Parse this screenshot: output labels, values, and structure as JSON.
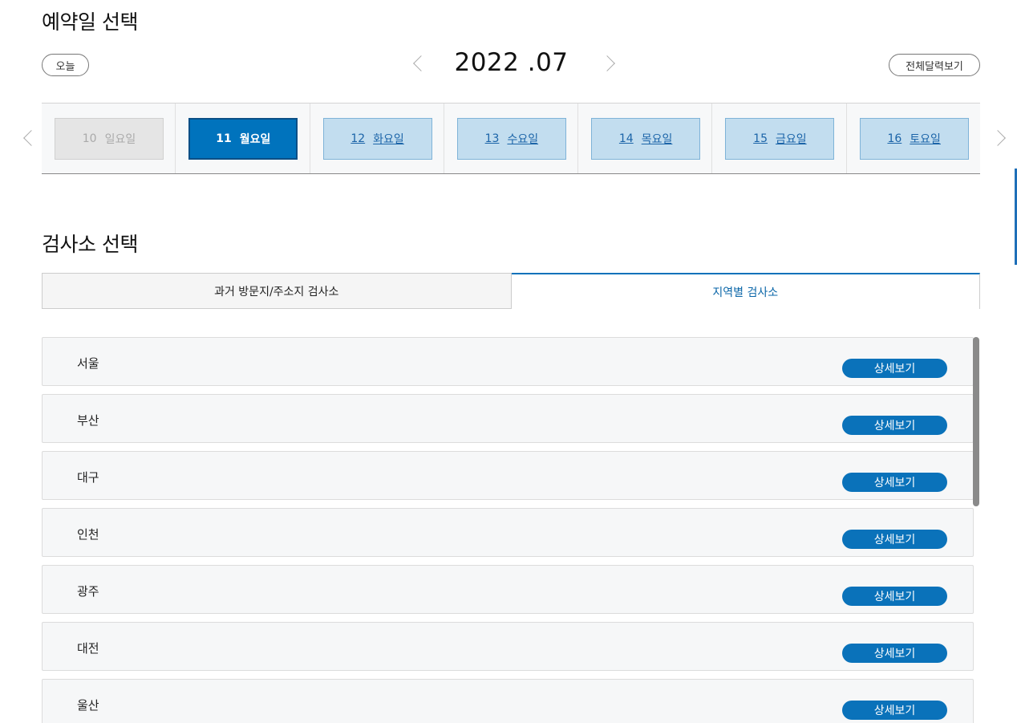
{
  "reservation": {
    "title": "예약일 선택",
    "today_label": "오늘",
    "month": "2022 .07",
    "full_calendar_label": "전체달력보기",
    "days": [
      {
        "date": "10",
        "weekday": "일요일",
        "state": "disabled"
      },
      {
        "date": "11",
        "weekday": "월요일",
        "state": "selected"
      },
      {
        "date": "12",
        "weekday": "화요일",
        "state": "available"
      },
      {
        "date": "13",
        "weekday": "수요일",
        "state": "available"
      },
      {
        "date": "14",
        "weekday": "목요일",
        "state": "available"
      },
      {
        "date": "15",
        "weekday": "금요일",
        "state": "available"
      },
      {
        "date": "16",
        "weekday": "토요일",
        "state": "available"
      }
    ]
  },
  "center": {
    "title": "검사소 선택",
    "tabs": [
      {
        "label": "과거 방문지/주소지 검사소",
        "active": false
      },
      {
        "label": "지역별 검사소",
        "active": true
      }
    ],
    "detail_label": "상세보기",
    "regions": [
      "서울",
      "부산",
      "대구",
      "인천",
      "광주",
      "대전",
      "울산"
    ]
  },
  "colors": {
    "accent": "#0a72ba",
    "selected_day": "#0073bd",
    "available_day": "#c2ddef",
    "disabled_day": "#e5e5e5"
  }
}
